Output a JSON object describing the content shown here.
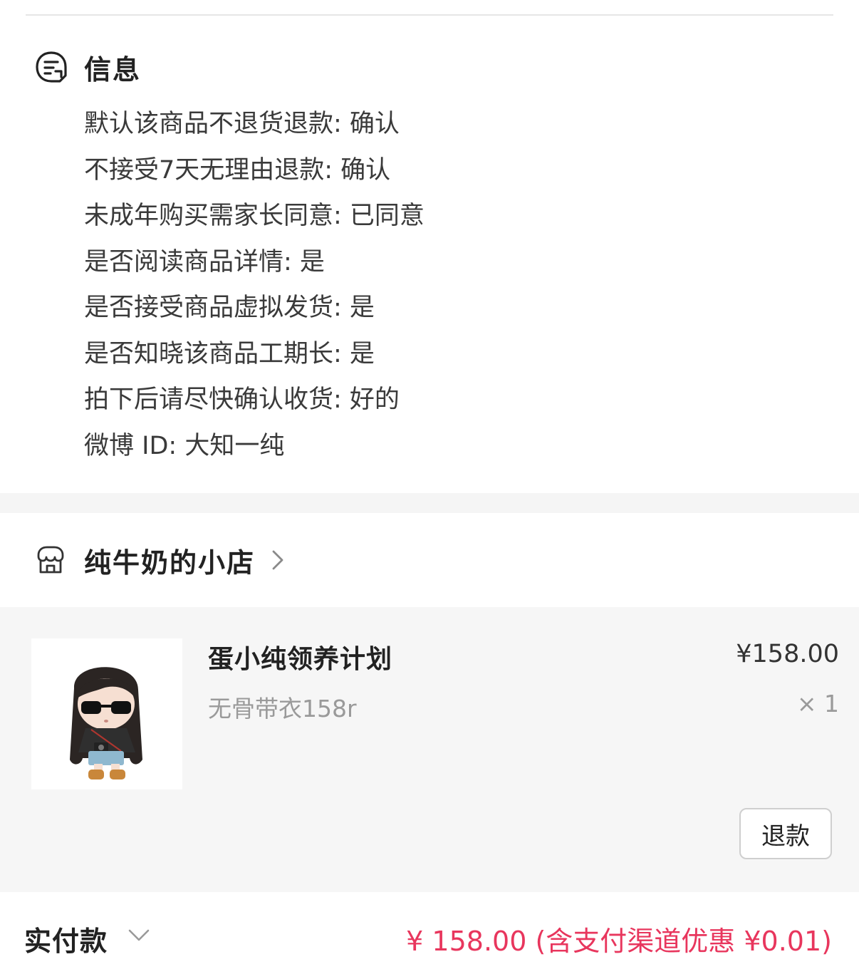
{
  "info": {
    "title": "信息",
    "lines": [
      "默认该商品不退货退款: 确认",
      "不接受7天无理由退款: 确认",
      "未成年购买需家长同意: 已同意",
      "是否阅读商品详情: 是",
      "是否接受商品虚拟发货: 是",
      "是否知晓该商品工期长: 是",
      "拍下后请尽快确认收货: 好的",
      "微博 ID: 大知一纯"
    ]
  },
  "shop": {
    "name": "纯牛奶的小店",
    "icon": "storefront-icon"
  },
  "item": {
    "title": "蛋小纯领养计划",
    "spec": "无骨带衣158r",
    "price": "¥158.00",
    "quantity": "× 1",
    "refund_label": "退款",
    "image": "chibi-doll-thumbnail"
  },
  "payment": {
    "label": "实付款",
    "amount": "¥ 158.00 (含支付渠道优惠 ¥0.01)"
  },
  "colors": {
    "accent_red": "#e8365d",
    "panel_bg": "#f6f6f6",
    "muted_text": "#9a9a9a"
  }
}
